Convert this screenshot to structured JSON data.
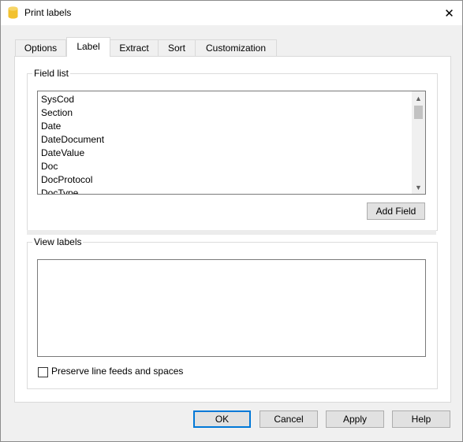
{
  "window": {
    "title": "Print labels",
    "close_glyph": "✕"
  },
  "tabs": [
    {
      "label": "Options"
    },
    {
      "label": "Label",
      "active": true
    },
    {
      "label": "Extract"
    },
    {
      "label": "Sort"
    },
    {
      "label": "Customization"
    }
  ],
  "field_list": {
    "label": "Field list",
    "items": [
      "SysCod",
      "Section",
      "Date",
      "DateDocument",
      "DateValue",
      "Doc",
      "DocProtocol",
      "DocType"
    ],
    "add_button": "Add Field"
  },
  "view_labels": {
    "label": "View labels",
    "text": "",
    "preserve_label": "Preserve line feeds and spaces",
    "preserve_checked": false
  },
  "buttons": {
    "ok": "OK",
    "cancel": "Cancel",
    "apply": "Apply",
    "help": "Help"
  },
  "icons": {
    "app": "database-icon",
    "close": "close-icon",
    "scroll_up": "arrow-up-icon",
    "scroll_down": "arrow-down-icon"
  },
  "colors": {
    "accent": "#0078d7",
    "app_icon": "#f2c12e"
  }
}
